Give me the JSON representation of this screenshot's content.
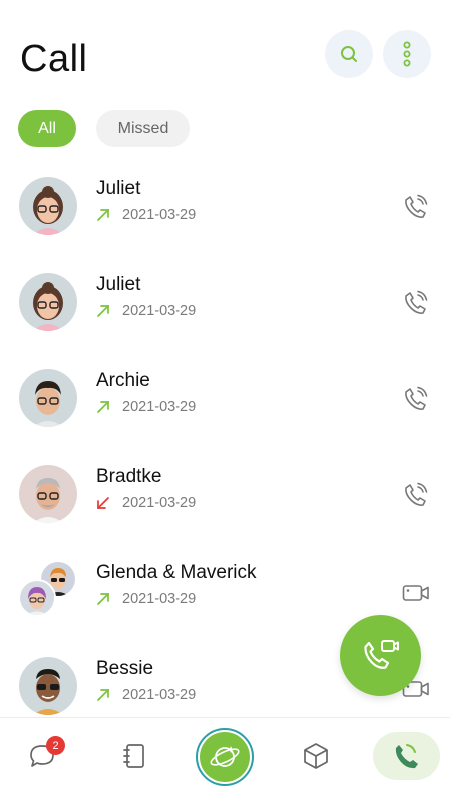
{
  "header": {
    "title": "Call"
  },
  "filters": {
    "all": "All",
    "missed": "Missed"
  },
  "calls": [
    {
      "name": "Juliet",
      "date": "2021-03-29",
      "direction": "outgoing",
      "type": "voice"
    },
    {
      "name": "Juliet",
      "date": "2021-03-29",
      "direction": "outgoing",
      "type": "voice"
    },
    {
      "name": "Archie",
      "date": "2021-03-29",
      "direction": "outgoing",
      "type": "voice"
    },
    {
      "name": "Bradtke",
      "date": "2021-03-29",
      "direction": "missed",
      "type": "voice"
    },
    {
      "name": "Glenda & Maverick",
      "date": "2021-03-29",
      "direction": "outgoing",
      "type": "video"
    },
    {
      "name": "Bessie",
      "date": "2021-03-29",
      "direction": "outgoing",
      "type": "video"
    }
  ],
  "bottom_nav": {
    "chats_badge": "2"
  },
  "colors": {
    "accent": "#7cc23f",
    "missed": "#e53935",
    "outgoing": "#7cc23f"
  },
  "icons": {
    "search": "search-icon",
    "more": "more-vertical-icon",
    "voice_call": "phone-call-icon",
    "video_call": "video-camera-icon"
  }
}
